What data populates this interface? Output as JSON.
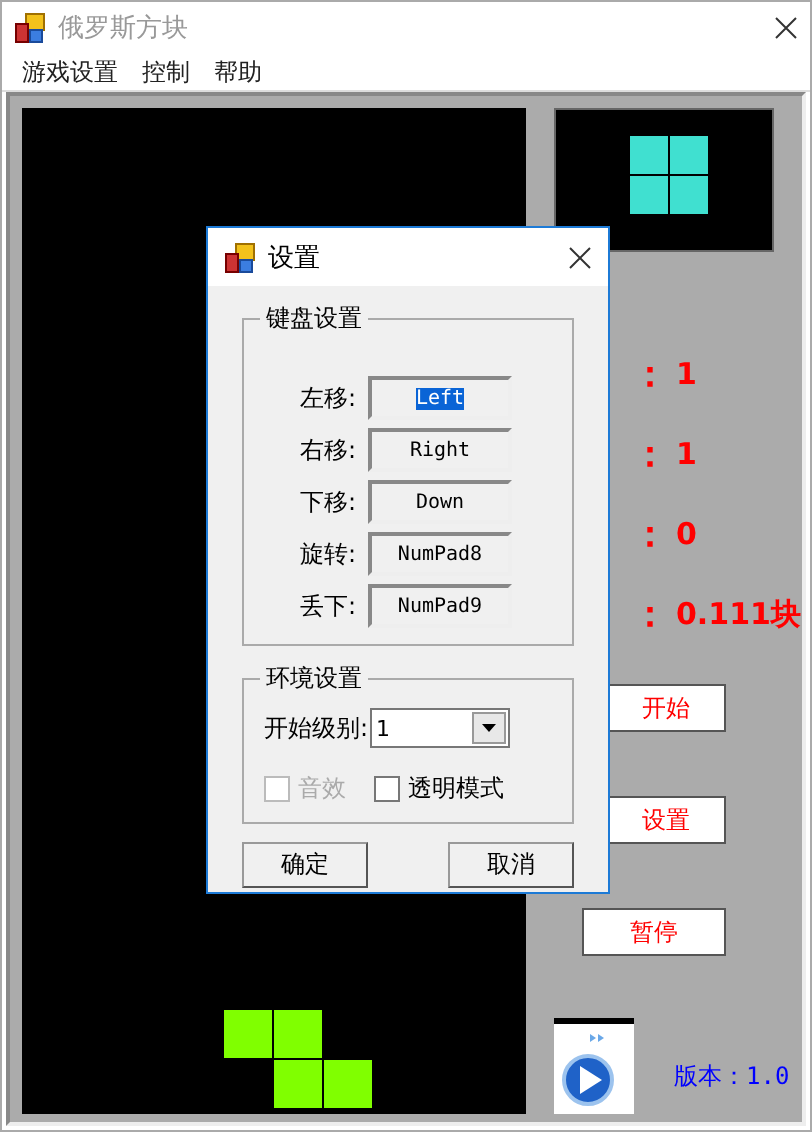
{
  "window": {
    "title": "俄罗斯方块"
  },
  "menu": [
    "游戏设置",
    "控制",
    "帮助"
  ],
  "board": {
    "kind": "z",
    "color": "#80ff00"
  },
  "next_piece": {
    "kind": "o",
    "color": "#40e0d0"
  },
  "stats": [
    {
      "label": "：",
      "value": "1"
    },
    {
      "label": "：",
      "value": "1"
    },
    {
      "label": "：",
      "value": "0"
    },
    {
      "label": "：",
      "value": "0.111块"
    }
  ],
  "buttons": [
    "开始",
    "设置",
    "暂停"
  ],
  "version": "版本：1.0",
  "dialog": {
    "title": "设置",
    "keyboard_group": "键盘设置",
    "keys": [
      {
        "label": "左移:",
        "value": "Left",
        "selected": true
      },
      {
        "label": "右移:",
        "value": "Right",
        "selected": false
      },
      {
        "label": "下移:",
        "value": "Down",
        "selected": false
      },
      {
        "label": "旋转:",
        "value": "NumPad8",
        "selected": false
      },
      {
        "label": "丢下:",
        "value": "NumPad9",
        "selected": false
      }
    ],
    "environment_group": "环境设置",
    "level_label": "开始级别:",
    "level_value": "1",
    "checkboxes": [
      {
        "label": "音效",
        "checked": false,
        "disabled": true
      },
      {
        "label": "透明模式",
        "checked": false,
        "disabled": false
      }
    ],
    "buttons": [
      "确定",
      "取消"
    ]
  }
}
